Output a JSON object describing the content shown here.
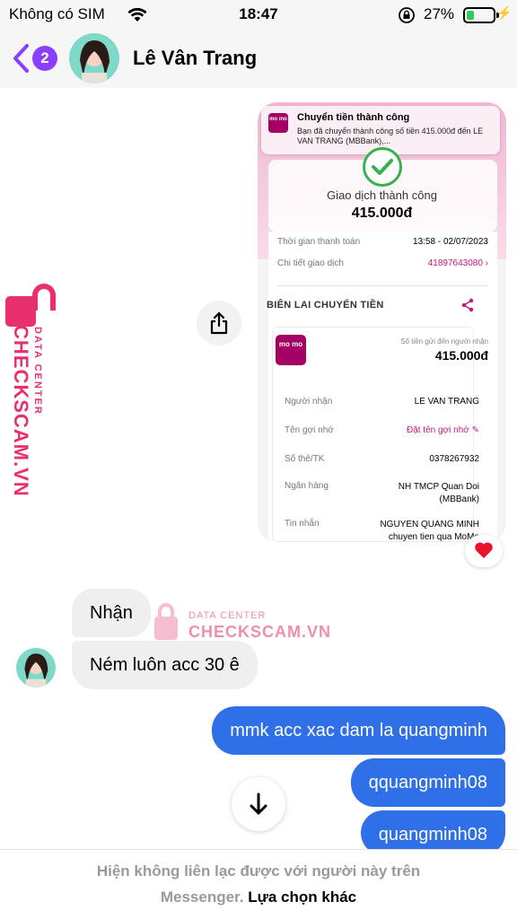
{
  "status_bar": {
    "carrier": "Không có SIM",
    "time": "18:47",
    "battery_percent": "27%",
    "battery_level": 0.27
  },
  "header": {
    "unread_count": "2",
    "contact_name": "Lê Vân Trang",
    "back_icon": "chevron-left-icon"
  },
  "shared_image": {
    "notification": {
      "title": "Chuyển tiền thành công",
      "body": "Bạn đã chuyển thành công số tiền 415.000đ đến LE VAN TRANG (MBBank),...",
      "logo_text": "mo mo"
    },
    "status_text": "Giao dịch thành công",
    "amount": "415.000đ",
    "payment_time_label": "Thời gian thanh toán",
    "payment_time_value": "13:58 - 02/07/2023",
    "detail_label": "Chi tiết giao dịch",
    "detail_value": "41897643080",
    "receipt_title": "BIÊN LAI CHUYỂN TIỀN",
    "receipt_amount_label": "Số tiền gửi đến người nhận",
    "receipt_amount": "415.000đ",
    "momo_logo_text": "mo mo",
    "rows": [
      {
        "label": "Người nhận",
        "value": "LE VAN TRANG"
      },
      {
        "label": "Tên gợi nhớ",
        "value": "Đặt tên gợi nhớ"
      },
      {
        "label": "Số thẻ/TK",
        "value": "0378267932"
      },
      {
        "label": "Ngân hàng",
        "value": "NH TMCP Quan Doi (MBBank)"
      },
      {
        "label": "Tin nhắn",
        "value": "NGUYEN QUANG MINH chuyen tien qua MoMo"
      }
    ]
  },
  "reaction": "heart-icon",
  "watermark": {
    "data_center": "DATA CENTER",
    "site": "CHECKSCAM.VN",
    "site_vertical": "CHECKSCAM.VN"
  },
  "messages": {
    "incoming": [
      "Nhận",
      "Ném luôn acc 30 ê"
    ],
    "outgoing": [
      "mmk acc xac dam la quangminh",
      "qquangminh08",
      "quangminh08"
    ]
  },
  "footer": {
    "notice": "Hiện không liên lạc được với người này trên",
    "notice_end": "Messenger.",
    "link": "Lựa chọn khác"
  },
  "colors": {
    "accent": "#8a3ffc",
    "outgoing_bubble": "#2f6fe8",
    "incoming_bubble": "#efefef",
    "momo": "#a50064",
    "watermark": "#e8306e"
  }
}
